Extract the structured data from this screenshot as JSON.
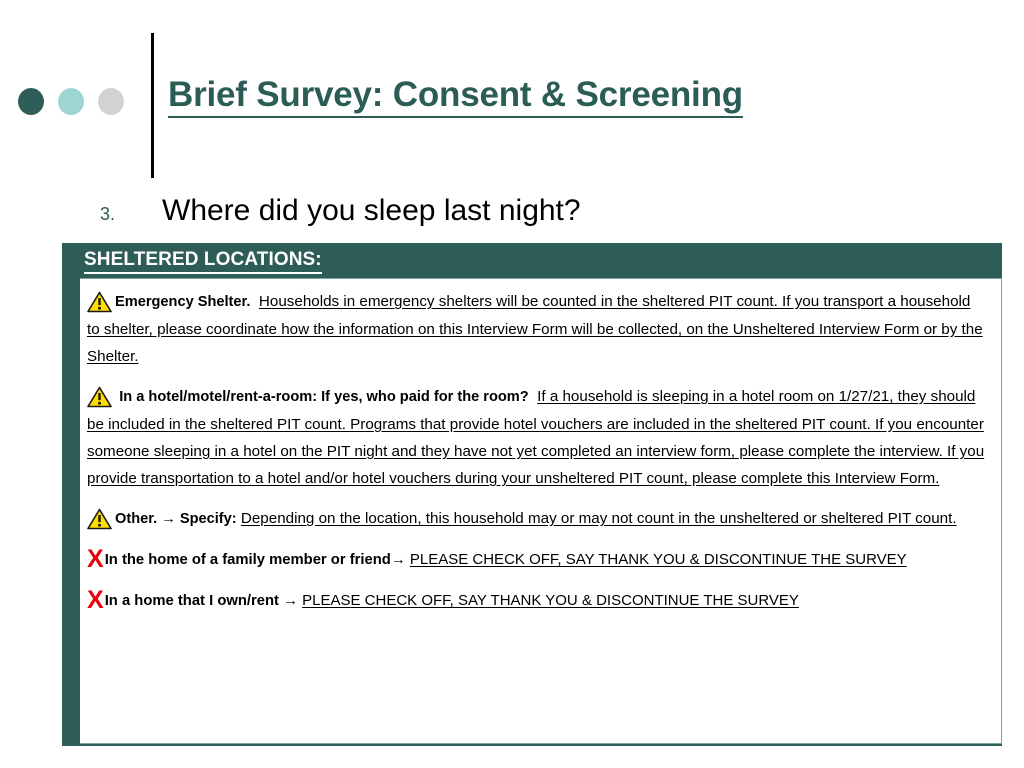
{
  "slide": {
    "title": "Brief Survey: Consent & Screening",
    "accent_color": "#2b5d55",
    "box_color": "#2e5d57",
    "warning_color": "#ffdd00",
    "x_color": "#e8000a"
  },
  "decor": {
    "dot_1_color": "#2f5e58",
    "dot_2_color": "#9ed4d2",
    "dot_3_color": "#d2d2d2"
  },
  "question": {
    "number": "3.",
    "text": "Where did you sleep last night?"
  },
  "answer_box": {
    "header": "SHELTERED LOCATIONS:",
    "entries": [
      {
        "marker": "warning-triangle",
        "lead": "Emergency Shelter.",
        "body": "Households in emergency shelters will be counted in the sheltered PIT count. If you transport a household to shelter, please coordinate how the information on this Interview Form will be collected, on the Unsheltered Interview Form or by the Shelter."
      },
      {
        "marker": "warning-triangle",
        "lead": "In a hotel/motel/rent-a-room: If yes, who paid for the room?",
        "body": "If a household is sleeping in a hotel room on 1/27/21, they should be included in the sheltered PIT count. Programs that provide hotel vouchers are included in the sheltered PIT count. If you encounter someone sleeping in a hotel on the PIT night and they have not yet completed an interview form, please complete the interview.  If you provide transportation to a hotel and/or hotel vouchers during your unsheltered PIT count, please complete this Interview Form."
      },
      {
        "marker": "warning-triangle",
        "lead": "Other.  → Specify:",
        "body": "Depending on the location, this household may or may not count in the unsheltered or sheltered PIT count."
      },
      {
        "marker": "red-x",
        "lead": "In the home of a family member or friend→",
        "body": "PLEASE CHECK OFF, SAY THANK YOU & DISCONTINUE THE SURVEY"
      },
      {
        "marker": "red-x",
        "lead": "In a home that I own/rent →",
        "body": "PLEASE CHECK OFF, SAY THANK YOU & DISCONTINUE THE SURVEY"
      }
    ]
  }
}
